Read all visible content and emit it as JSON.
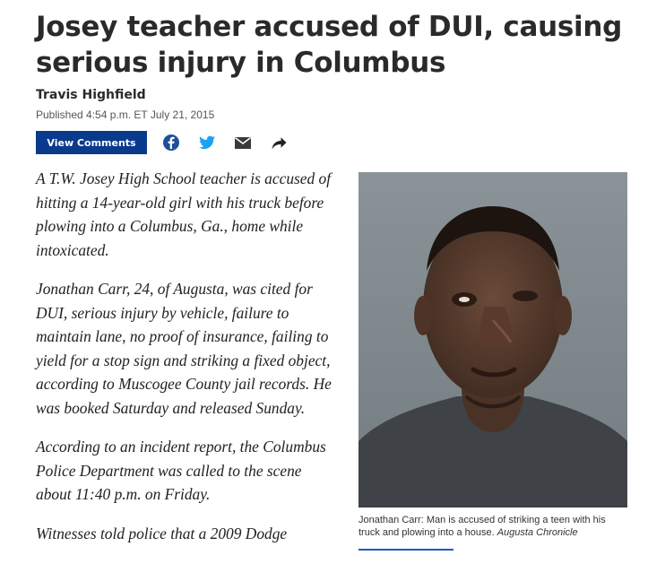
{
  "article": {
    "headline": "Josey teacher accused of DUI, causing serious injury in Columbus",
    "author": "Travis Highfield",
    "published": "Published 4:54 p.m. ET July 21, 2015",
    "view_comments_label": "View Comments",
    "share_icons": [
      "facebook-icon",
      "twitter-icon",
      "email-icon",
      "share-arrow-icon"
    ],
    "paragraphs": [
      "A T.W. Josey High School teacher is accused of hitting a 14-year-old girl with his truck before plowing into a Columbus, Ga., home while intoxicated.",
      "Jonathan Carr, 24, of Augusta, was cited for DUI, serious injury by vehicle, failure to maintain lane, no proof of insurance, failing to yield for a stop sign and striking a fixed object, according to Muscogee County jail records. He was booked Saturday and released Sunday.",
      "According to an incident report, the Columbus Police Department was called to the scene about 11:40 p.m. on Friday.",
      "Witnesses told police that a 2009 Dodge"
    ],
    "photo": {
      "caption": "Jonathan Carr: Man is accused of striking a teen with his truck and plowing into a house.",
      "credit": "Augusta Chronicle"
    }
  },
  "colors": {
    "button_bg": "#0a3a8c",
    "facebook": "#1f4f9a",
    "twitter": "#1da1f2",
    "icon_dark": "#3a3a3a",
    "caption_rule": "#1e5bc6"
  }
}
